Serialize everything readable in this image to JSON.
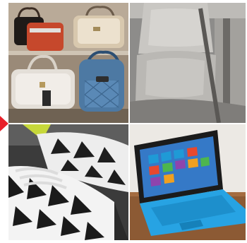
{
  "tiles": [
    {
      "subject": "handbags"
    },
    {
      "subject": "car-seat"
    },
    {
      "subject": "sneakers"
    },
    {
      "subject": "tablet-with-keyboard"
    }
  ],
  "accent_color": "#e8202a"
}
